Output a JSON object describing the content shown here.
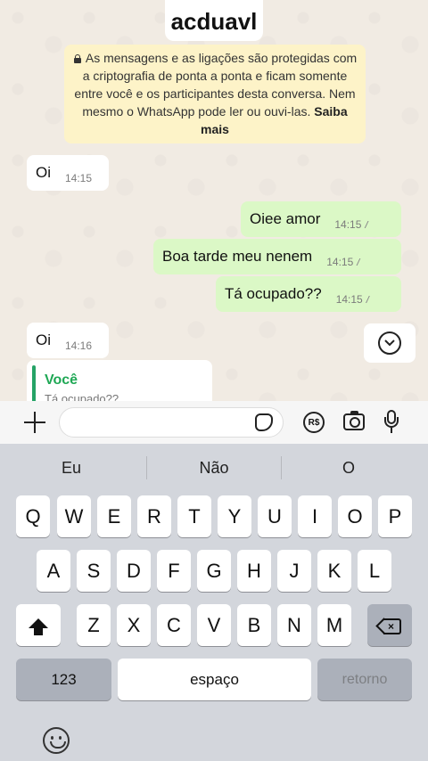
{
  "contact": {
    "name": "acduavl"
  },
  "encryption_notice": {
    "text": "As mensagens e as ligações são protegidas com a criptografia de ponta a ponta e ficam somente entre você e os participantes desta conversa. Nem mesmo o WhatsApp pode ler ou ouvi-las.",
    "link": "Saiba mais"
  },
  "messages": [
    {
      "direction": "in",
      "text": "Oi",
      "time": "14:15"
    },
    {
      "direction": "out",
      "text": "Oiee amor",
      "time": "14:15",
      "ticks": "//"
    },
    {
      "direction": "out",
      "text": "Boa tarde meu nenem",
      "time": "14:15",
      "ticks": "//"
    },
    {
      "direction": "out",
      "text": "Tá ocupado??",
      "time": "14:15",
      "ticks": "//"
    },
    {
      "direction": "in",
      "text": "Oi",
      "time": "14:16"
    }
  ],
  "reply_preview": {
    "author": "Você",
    "quoted": "Tá ocupado??"
  },
  "input_bar": {
    "placeholder": "",
    "pay_label": "R$"
  },
  "keyboard": {
    "suggestions": [
      "Eu",
      "Não",
      "O"
    ],
    "row1": [
      "Q",
      "W",
      "E",
      "R",
      "T",
      "Y",
      "U",
      "I",
      "O",
      "P"
    ],
    "row2": [
      "A",
      "S",
      "D",
      "F",
      "G",
      "H",
      "J",
      "K",
      "L"
    ],
    "row3": [
      "Z",
      "X",
      "C",
      "V",
      "B",
      "N",
      "M"
    ],
    "numbers_label": "123",
    "space_label": "espaço",
    "return_label": "retorno"
  },
  "colors": {
    "outgoing_bubble": "#dbf8c6",
    "incoming_bubble": "#ffffff",
    "notice_bg": "#fdf3c8",
    "reply_accent": "#1fa855"
  },
  "icons": [
    "lock-icon",
    "chevron-down-icon",
    "plus-icon",
    "sticker-icon",
    "payment-icon",
    "camera-icon",
    "microphone-icon",
    "shift-icon",
    "backspace-icon",
    "emoji-icon"
  ]
}
